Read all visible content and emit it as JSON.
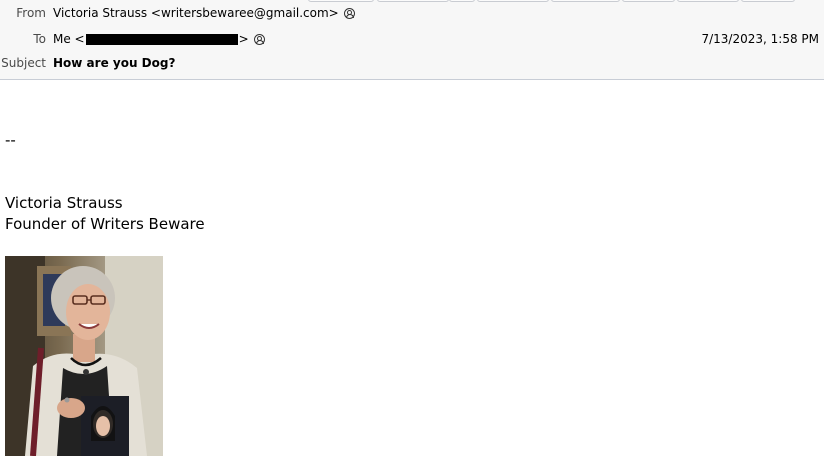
{
  "header": {
    "from_label": "From",
    "from_value": "Victoria Strauss <writersbewaree@gmail.com>",
    "to_label": "To",
    "to_prefix": "Me <",
    "to_suffix": ">",
    "date": "7/13/2023, 1:58 PM",
    "subject_label": "Subject",
    "subject_value": "How are you Dog?"
  },
  "body": {
    "separator": "--",
    "signature_name": "Victoria Strauss",
    "signature_title": "Founder of Writers Beware"
  },
  "icons": {
    "contact": "person-circle-icon",
    "redaction": "redacted-text-bar",
    "photo": "signature-photo"
  },
  "colors": {
    "header_bg": "#f7f7f7",
    "header_border": "#c8cdd6",
    "label_text": "#4a4a4a"
  }
}
